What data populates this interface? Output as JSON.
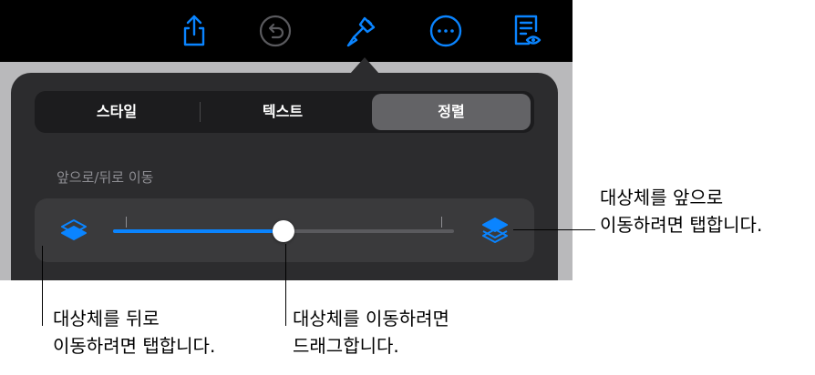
{
  "toolbar": {
    "icons": [
      "share-icon",
      "undo-icon",
      "format-brush-icon",
      "more-icon",
      "reading-view-icon"
    ],
    "accent": "#0a84ff"
  },
  "format_popover": {
    "tabs": [
      {
        "label": "스타일",
        "selected": false
      },
      {
        "label": "텍스트",
        "selected": false
      },
      {
        "label": "정렬",
        "selected": true
      }
    ],
    "section_label": "앞으로/뒤로 이동",
    "slider": {
      "value": 0.5
    }
  },
  "callouts": {
    "bring_forward": "대상체를 앞으로\n이동하려면 탭합니다.",
    "send_backward": "대상체를 뒤로\n이동하려면 탭합니다.",
    "drag": "대상체를 이동하려면\n드래그합니다."
  }
}
